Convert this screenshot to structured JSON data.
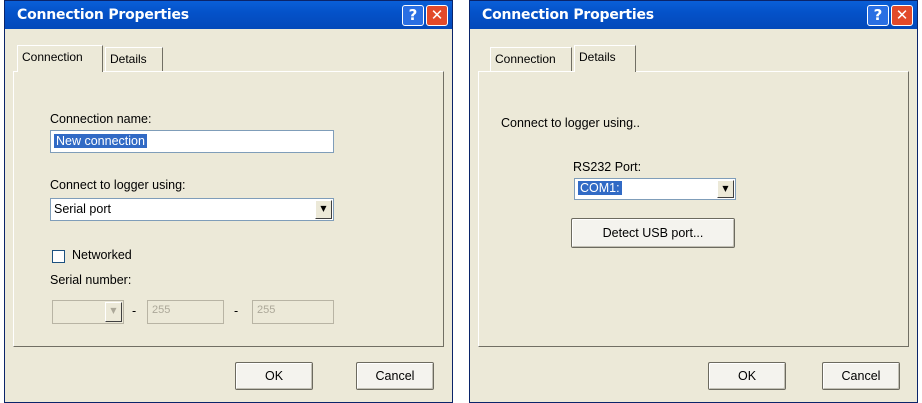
{
  "left_dialog": {
    "title": "Connection Properties",
    "help_glyph": "?",
    "close_glyph": "✕",
    "tabs": [
      {
        "label": "Connection",
        "active": true
      },
      {
        "label": "Details",
        "active": false
      }
    ],
    "connection_name_label": "Connection name:",
    "connection_name_value": "New connection",
    "connect_using_label": "Connect to logger using:",
    "connect_using_value": "Serial port",
    "networked_label": "Networked",
    "networked_checked": false,
    "serial_number_label": "Serial number:",
    "serial_part1": "",
    "serial_sep": "-",
    "serial_part2": "255",
    "serial_part3": "255",
    "ok_label": "OK",
    "cancel_label": "Cancel"
  },
  "right_dialog": {
    "title": "Connection Properties",
    "help_glyph": "?",
    "close_glyph": "✕",
    "tabs": [
      {
        "label": "Connection",
        "active": false
      },
      {
        "label": "Details",
        "active": true
      }
    ],
    "connect_using_text": "Connect to logger using..",
    "rs232_label": "RS232 Port:",
    "rs232_value": "COM1:",
    "detect_usb_label": "Detect USB port...",
    "ok_label": "OK",
    "cancel_label": "Cancel"
  },
  "colors": {
    "titlebar": "#0452C9",
    "dialog_bg": "#ECE9D8",
    "selection": "#316AC5",
    "close_button": "#E24A2A"
  }
}
